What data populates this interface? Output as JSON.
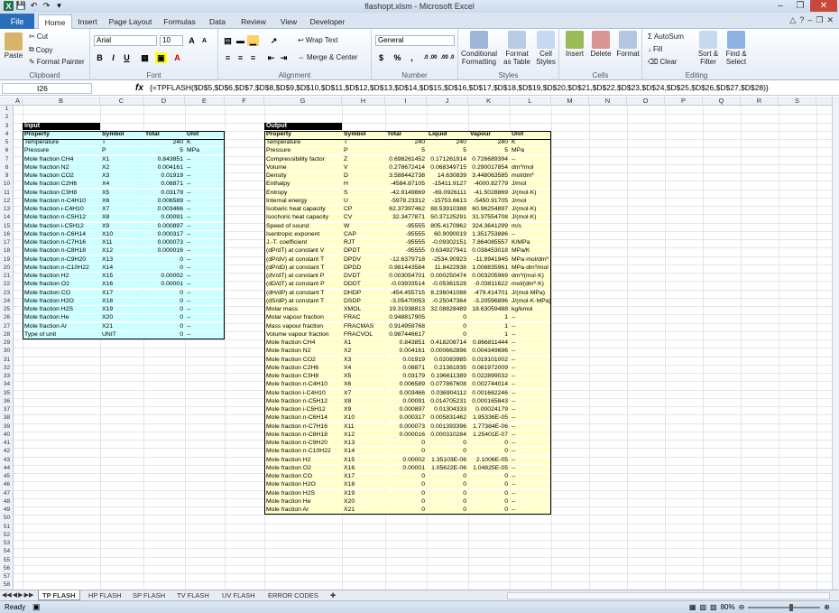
{
  "window": {
    "title": "flashopt.xlsm - Microsoft Excel"
  },
  "ribbon_tabs": [
    "File",
    "Home",
    "Insert",
    "Page Layout",
    "Formulas",
    "Data",
    "Review",
    "View",
    "Developer"
  ],
  "clipboard": {
    "paste": "Paste",
    "cut": "Cut",
    "copy": "Copy",
    "format_painter": "Format Painter",
    "label": "Clipboard"
  },
  "font": {
    "name": "Arial",
    "size": "10",
    "bold": "B",
    "italic": "I",
    "underline": "U",
    "grow": "A",
    "shrink": "A",
    "color": "A",
    "label": "Font"
  },
  "alignment": {
    "wrap": "Wrap Text",
    "merge": "Merge & Center",
    "label": "Alignment"
  },
  "number": {
    "format": "General",
    "currency": "$",
    "percent": "%",
    "comma": ",",
    "inc_dec": ".0 .00",
    "dec_dec": ".00 .0",
    "label": "Number"
  },
  "styles": {
    "conditional": "Conditional Formatting",
    "format_table": "Format as Table",
    "cell_styles": "Cell Styles",
    "label": "Styles"
  },
  "cells": {
    "insert": "Insert",
    "delete": "Delete",
    "format": "Format",
    "label": "Cells"
  },
  "editing": {
    "autosum": "AutoSum",
    "fill": "Fill",
    "clear": "Clear",
    "sort": "Sort & Filter",
    "find": "Find & Select",
    "label": "Editing"
  },
  "formula_bar": {
    "name_box": "I26",
    "fx": "fx",
    "formula": "{=TPFLASH($D$5,$D$6,$D$7,$D$8,$D$9,$D$10,$D$11,$D$12,$D$13,$D$14,$D$15,$D$16,$D$17,$D$18,$D$19,$D$20,$D$21,$D$22,$D$23,$D$24,$D$25,$D$26,$D$27,$D$28)}"
  },
  "columns": [
    "A",
    "B",
    "C",
    "D",
    "E",
    "F",
    "G",
    "H",
    "I",
    "J",
    "K",
    "L",
    "M",
    "N",
    "O",
    "P",
    "Q",
    "R",
    "S"
  ],
  "rows": [
    "1",
    "2",
    "3",
    "4",
    "5",
    "6",
    "7",
    "8",
    "9",
    "10",
    "11",
    "12",
    "13",
    "14",
    "15",
    "16",
    "17",
    "18",
    "19",
    "20",
    "21",
    "22",
    "23",
    "24",
    "25",
    "26",
    "27",
    "28",
    "29",
    "30",
    "31",
    "32",
    "33",
    "34",
    "35",
    "36",
    "37",
    "38",
    "39",
    "40",
    "41",
    "42",
    "43",
    "44",
    "45",
    "46",
    "47",
    "48",
    "49",
    "50",
    "51",
    "52",
    "53",
    "54",
    "55",
    "56",
    "57",
    "58"
  ],
  "input_table": {
    "title": "Input",
    "headers": [
      "Property",
      "Symbol",
      "Total",
      "Unit"
    ],
    "rows": [
      [
        "Temperature",
        "T",
        "240",
        "K"
      ],
      [
        "Pressure",
        "P",
        "5",
        "MPa"
      ],
      [
        "Mole fraction CH4",
        "X1",
        "0.843851",
        "--"
      ],
      [
        "Mole fraction N2",
        "X2",
        "0.004161",
        "--"
      ],
      [
        "Mole fraction CO2",
        "X3",
        "0.01919",
        "--"
      ],
      [
        "Mole fraction C2H6",
        "X4",
        "0.08871",
        "--"
      ],
      [
        "Mole fraction C3H8",
        "X5",
        "0.03179",
        "--"
      ],
      [
        "Mole fraction n-C4H10",
        "X6",
        "0.006589",
        "--"
      ],
      [
        "Mole fraction i-C4H10",
        "X7",
        "0.003466",
        "--"
      ],
      [
        "Mole fraction n-C5H12",
        "X8",
        "0.00091",
        "--"
      ],
      [
        "Mole fraction i-C5H12",
        "X9",
        "0.000897",
        "--"
      ],
      [
        "Mole fraction n-C6H14",
        "X10",
        "0.000317",
        "--"
      ],
      [
        "Mole fraction n-C7H16",
        "X11",
        "0.000073",
        "--"
      ],
      [
        "Mole fraction n-C8H18",
        "X12",
        "0.000016",
        "--"
      ],
      [
        "Mole fraction n-C9H20",
        "X13",
        "0",
        "--"
      ],
      [
        "Mole fraction n-C10H22",
        "X14",
        "0",
        "--"
      ],
      [
        "Mole fraction H2",
        "X15",
        "0.00002",
        "--"
      ],
      [
        "Mole fraction O2",
        "X16",
        "0.00001",
        "--"
      ],
      [
        "Mole fraction CO",
        "X17",
        "0",
        "--"
      ],
      [
        "Mole fraction H2O",
        "X18",
        "0",
        "--"
      ],
      [
        "Mole fraction H2S",
        "X19",
        "0",
        "--"
      ],
      [
        "Mole fraction He",
        "X20",
        "0",
        "--"
      ],
      [
        "Mole fraction Ar",
        "X21",
        "0",
        "--"
      ],
      [
        "Type of unit",
        "UNIT",
        "0",
        "--"
      ]
    ]
  },
  "output_table": {
    "title": "Output",
    "headers": [
      "Property",
      "Symbol",
      "Total",
      "Liquid",
      "Vapour",
      "Unit"
    ],
    "rows": [
      [
        "Temperature",
        "T",
        "240",
        "240",
        "240",
        "K"
      ],
      [
        "Pressure",
        "P",
        "5",
        "5",
        "5",
        "MPa"
      ],
      [
        "Compressibility factor",
        "Z",
        "0.698261452",
        "0.171261914",
        "0.726689394",
        "--"
      ],
      [
        "Volume",
        "V",
        "0.278672414",
        "0.068349715",
        "0.290017854",
        "dm³/mol"
      ],
      [
        "Density",
        "D",
        "3.588442738",
        "14.630839",
        "3.448063585",
        "mol/dm³"
      ],
      [
        "Enthalpy",
        "H",
        "-4584.87105",
        "-15411.9127",
        "-4000.82779",
        "J/mol"
      ],
      [
        "Entropy",
        "S",
        "-42.9149869",
        "-69.0926111",
        "-41.5028869",
        "J/(mol·K)"
      ],
      [
        "Internal energy",
        "U",
        "-5978.23312",
        "-15753.6613",
        "-5450.91705",
        "J/mol"
      ],
      [
        "Isobaric heat capacity",
        "CP",
        "62.37397462",
        "88.53910388",
        "60.96254897",
        "J/(mol·K)"
      ],
      [
        "Isochoric heat capacity",
        "CV",
        "32.3477871",
        "50.37125291",
        "31.37554708",
        "J/(mol·K)"
      ],
      [
        "Speed of sound",
        "W",
        "-95555",
        "805.4170962",
        "324.3641299",
        "m/s"
      ],
      [
        "Isentropic exponent",
        "CAP",
        "-95555",
        "60.9090019",
        "1.351753886",
        "--"
      ],
      [
        "J.-T. coefficient",
        "RJT",
        "-95555",
        "-0.09302151",
        "7.864085557",
        "K/MPa"
      ],
      [
        "(dP/dT) at constant V",
        "DPDT",
        "-95555",
        "0.634927941",
        "0.038453018",
        "MPa/K"
      ],
      [
        "(dP/dV) at constant T",
        "DPDV",
        "-12.6379718",
        "-2534.90923",
        "-11.9941945",
        "MPa·mol/dm³"
      ],
      [
        "(dP/dD) at constant T",
        "DPDD",
        "0.981443584",
        "11.8422938",
        "1.008835961",
        "MPa·dm³/mol"
      ],
      [
        "(dV/dT) at constant P",
        "DVDT",
        "0.003054701",
        "0.000250474",
        "0.003205969",
        "dm³/(mol·K)"
      ],
      [
        "(dD/dT) at constant P",
        "DDDT",
        "-0.03933514",
        "-0.05361528",
        "-0.03811622",
        "mol/(dm³·K)"
      ],
      [
        "(dH/dP) at constant T",
        "DHDP",
        "-454.455715",
        "8.236041088",
        "-479.414701",
        "J/(mol·MPa)"
      ],
      [
        "(dS/dP) at constant T",
        "DSDP",
        "-3.05470053",
        "-0.25047364",
        "-3.20596896",
        "J/(mol·K·MPa)"
      ],
      [
        "Molar mass",
        "XMOL",
        "19.31938813",
        "32.08828489",
        "18.63059488",
        "kg/kmol"
      ],
      [
        "Molar vapour fraction",
        "FRAC",
        "0.948817905",
        "0",
        "1",
        "--"
      ],
      [
        "Mass vapour fraction",
        "FRACMAS",
        "0.914959768",
        "0",
        "1",
        "--"
      ],
      [
        "Volume vapour fraction",
        "FRACVOL",
        "0.987446617",
        "0",
        "1",
        "--"
      ],
      [
        "Mole fraction CH4",
        "X1",
        "0.843851",
        "0.418208714",
        "0.866811444",
        "--"
      ],
      [
        "Mole fraction N2",
        "X2",
        "0.004161",
        "0.000662896",
        "0.004349696",
        "--"
      ],
      [
        "Mole fraction CO2",
        "X3",
        "0.01919",
        "0.02083985",
        "0.019101002",
        "--"
      ],
      [
        "Mole fraction C2H6",
        "X4",
        "0.08871",
        "0.21361935",
        "0.081972009",
        "--"
      ],
      [
        "Mole fraction C3H8",
        "X5",
        "0.03179",
        "0.196611389",
        "0.022899032",
        "--"
      ],
      [
        "Mole fraction n-C4H10",
        "X6",
        "0.006589",
        "0.077867608",
        "0.002744014",
        "--"
      ],
      [
        "Mole fraction i-C4H10",
        "X7",
        "0.003466",
        "0.036904112",
        "0.001662246",
        "--"
      ],
      [
        "Mole fraction n-C5H12",
        "X8",
        "0.00091",
        "0.014705231",
        "0.000165843",
        "--"
      ],
      [
        "Mole fraction i-C5H12",
        "X9",
        "0.000897",
        "0.01304333",
        "0.00024179",
        "--"
      ],
      [
        "Mole fraction n-C6H14",
        "X10",
        "0.000317",
        "0.005831462",
        "1.95336E-05",
        "--"
      ],
      [
        "Mole fraction n-C7H16",
        "X11",
        "0.000073",
        "0.001393396",
        "1.77384E-06",
        "--"
      ],
      [
        "Mole fraction n-C8H18",
        "X12",
        "0.000016",
        "0.000310284",
        "1.25401E-07",
        "--"
      ],
      [
        "Mole fraction n-C9H20",
        "X13",
        "0",
        "0",
        "0",
        "--"
      ],
      [
        "Mole fraction n-C10H22",
        "X14",
        "0",
        "0",
        "0",
        "--"
      ],
      [
        "Mole fraction H2",
        "X15",
        "0.00002",
        "1.35103E-06",
        "2.1006E-05",
        "--"
      ],
      [
        "Mole fraction O2",
        "X16",
        "0.00001",
        "1.05622E-06",
        "1.04825E-05",
        "--"
      ],
      [
        "Mole fraction CO",
        "X17",
        "0",
        "0",
        "0",
        "--"
      ],
      [
        "Mole fraction H2O",
        "X18",
        "0",
        "0",
        "0",
        "--"
      ],
      [
        "Mole fraction H2S",
        "X19",
        "0",
        "0",
        "0",
        "--"
      ],
      [
        "Mole fraction He",
        "X20",
        "0",
        "0",
        "0",
        "--"
      ],
      [
        "Mole fraction Ar",
        "X21",
        "0",
        "0",
        "0",
        "--"
      ]
    ]
  },
  "sheet_tabs": [
    "TP FLASH",
    "HP FLASH",
    "SP FLASH",
    "TV FLASH",
    "UV FLASH",
    "ERROR CODES"
  ],
  "status": {
    "ready": "Ready",
    "zoom": "80%"
  }
}
